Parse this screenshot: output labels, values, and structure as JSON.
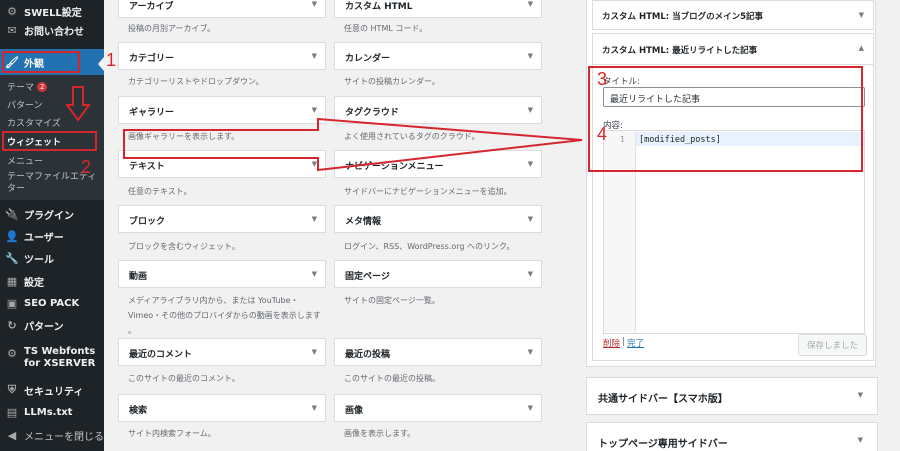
{
  "sidebar": {
    "top_items": [
      {
        "label": "SWELL設定",
        "icon": "gear-icon"
      },
      {
        "label": "お問い合わせ",
        "icon": "envelope-icon"
      }
    ],
    "appearance": {
      "label": "外観",
      "icon": "paintbrush-icon"
    },
    "submenu": [
      {
        "label": "テーマ",
        "badge": "2"
      },
      {
        "label": "パターン"
      },
      {
        "label": "カスタマイズ"
      },
      {
        "label": "ウィジェット"
      },
      {
        "label": "メニュー"
      },
      {
        "label": "テーマファイルエディター"
      }
    ],
    "bottom_items": [
      {
        "label": "プラグイン",
        "icon": "plug-icon"
      },
      {
        "label": "ユーザー",
        "icon": "user-icon"
      },
      {
        "label": "ツール",
        "icon": "wrench-icon"
      },
      {
        "label": "設定",
        "icon": "settings-icon"
      },
      {
        "label": "SEO PACK",
        "icon": "seo-icon"
      },
      {
        "label": "パターン",
        "icon": "pattern-icon"
      },
      {
        "label": "TS Webfonts for XSERVER",
        "icon": "font-icon"
      },
      {
        "label": "セキュリティ",
        "icon": "shield-icon"
      },
      {
        "label": "LLMs.txt",
        "icon": "document-icon"
      },
      {
        "label": "メニューを閉じる",
        "icon": "collapse-icon"
      }
    ]
  },
  "widgets": {
    "left": [
      {
        "title": "アーカイブ",
        "desc": "投稿の月別アーカイブ。"
      },
      {
        "title": "カテゴリー",
        "desc": "カテゴリーリストやドロップダウン。"
      },
      {
        "title": "ギャラリー",
        "desc": "画像ギャラリーを表示します。"
      },
      {
        "title": "テキスト",
        "desc": "任意のテキスト。"
      },
      {
        "title": "ブロック",
        "desc": "ブロックを含むウィジェット。"
      },
      {
        "title": "動画",
        "desc": "メディアライブラリ内から、または YouTube・\nVimeo・その他のプロバイダからの動画を表示します\n。"
      },
      {
        "title": "最近のコメント",
        "desc": "このサイトの最近のコメント。"
      },
      {
        "title": "検索",
        "desc": "サイト内検索フォーム。"
      }
    ],
    "right": [
      {
        "title": "カスタム HTML",
        "desc": "任意の HTML コード。"
      },
      {
        "title": "カレンダー",
        "desc": "サイトの投稿カレンダー。"
      },
      {
        "title": "タグクラウド",
        "desc": "よく使用されているタグのクラウド。"
      },
      {
        "title": "ナビゲーションメニュー",
        "desc": "サイドバーにナビゲーションメニューを追加。"
      },
      {
        "title": "メタ情報",
        "desc": "ログイン、RSS、WordPress.org へのリンク。"
      },
      {
        "title": "固定ページ",
        "desc": "サイトの固定ページ一覧。"
      },
      {
        "title": "最近の投稿",
        "desc": "このサイトの最近の投稿。"
      },
      {
        "title": "画像",
        "desc": "画像を表示します。"
      }
    ]
  },
  "sidebar_area": {
    "collapsed_widget_title": "カスタム HTML: 当ブログのメイン5記事",
    "expanded_widget_title": "カスタム HTML: 最近リライトした記事",
    "title_label": "タイトル:",
    "title_value": "最近リライトした記事",
    "content_label": "内容:",
    "code_line_number": "1",
    "code_content": "[modified_posts]",
    "delete_link": "削除",
    "separator": "|",
    "done_link": "完了",
    "save_button": "保存しました",
    "smartphone_sidebar_title": "共通サイドバー【スマホ版】",
    "top_page_sidebar_title": "トップページ専用サイドバー"
  },
  "annotations": {
    "n1": "1",
    "n2": "2",
    "n3": "3",
    "n4": "4",
    "color": "#d6262d"
  },
  "colors": {
    "sidebar_bg": "#1d2327",
    "active_menu": "#2271b1",
    "link": "#2271b1",
    "delete_link": "#b32d2e"
  }
}
